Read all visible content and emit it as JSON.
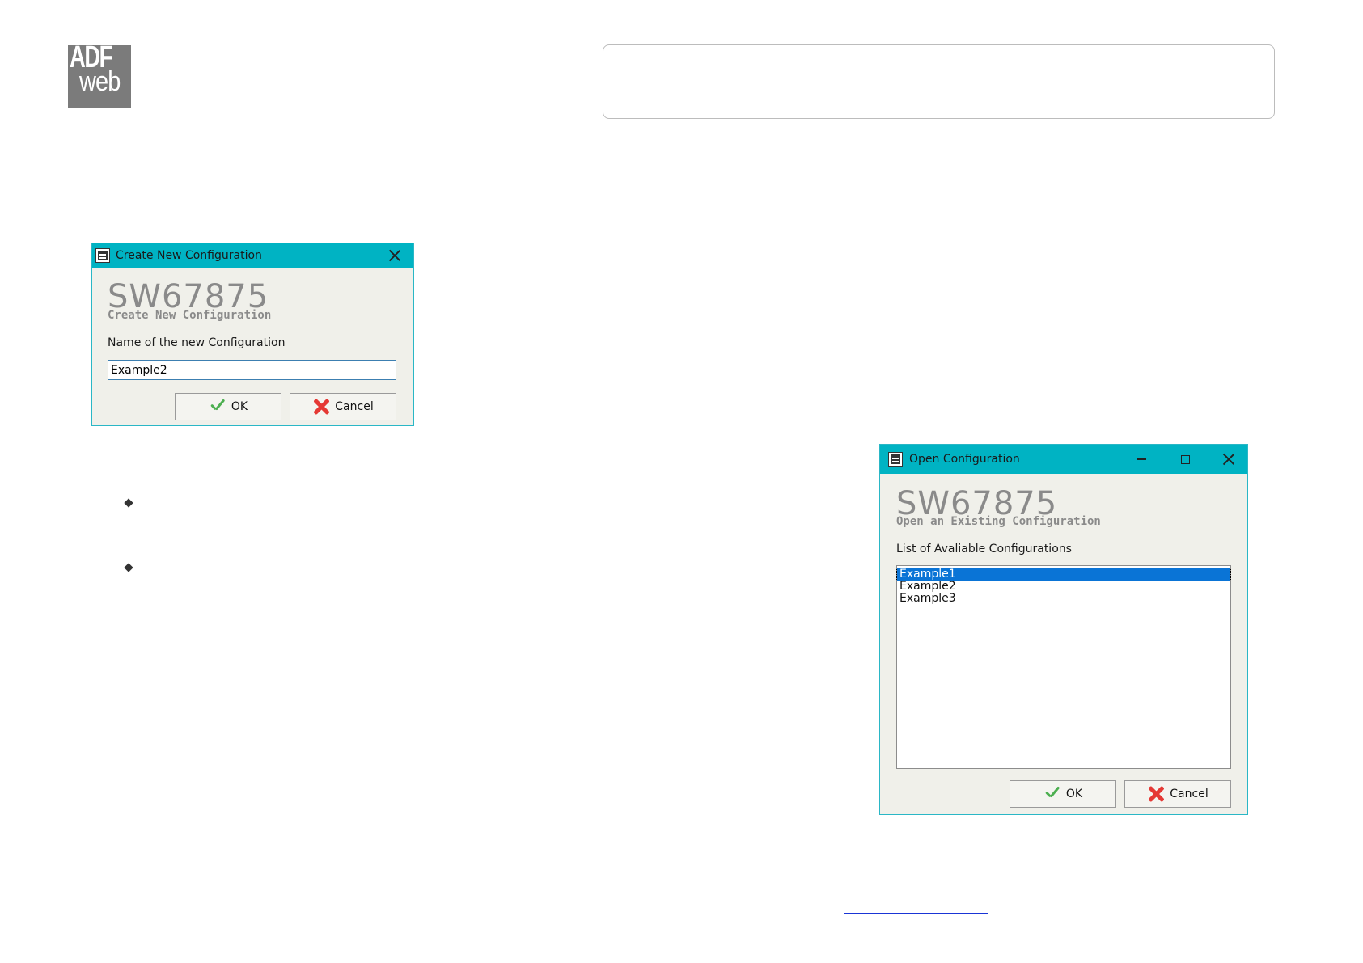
{
  "logo": {
    "line1": "ADF",
    "line2": "web"
  },
  "create_dialog": {
    "title": "Create New Configuration",
    "product_code": "SW67875",
    "subtitle": "Create New Configuration",
    "field_label": "Name of the new Configuration",
    "field_value": "Example2",
    "ok_label": "OK",
    "cancel_label": "Cancel"
  },
  "open_dialog": {
    "title": "Open Configuration",
    "product_code": "SW67875",
    "subtitle": "Open an Existing Configuration",
    "list_label": "List of Avaliable Configurations",
    "items": [
      "Example1",
      "Example2",
      "Example3"
    ],
    "selected_index": 0,
    "ok_label": "OK",
    "cancel_label": "Cancel"
  },
  "colors": {
    "titlebar": "#00b3c3",
    "dialog_bg": "#f0f0ea",
    "selection": "#0a74d6",
    "accent_text": "#8a8a8a"
  }
}
